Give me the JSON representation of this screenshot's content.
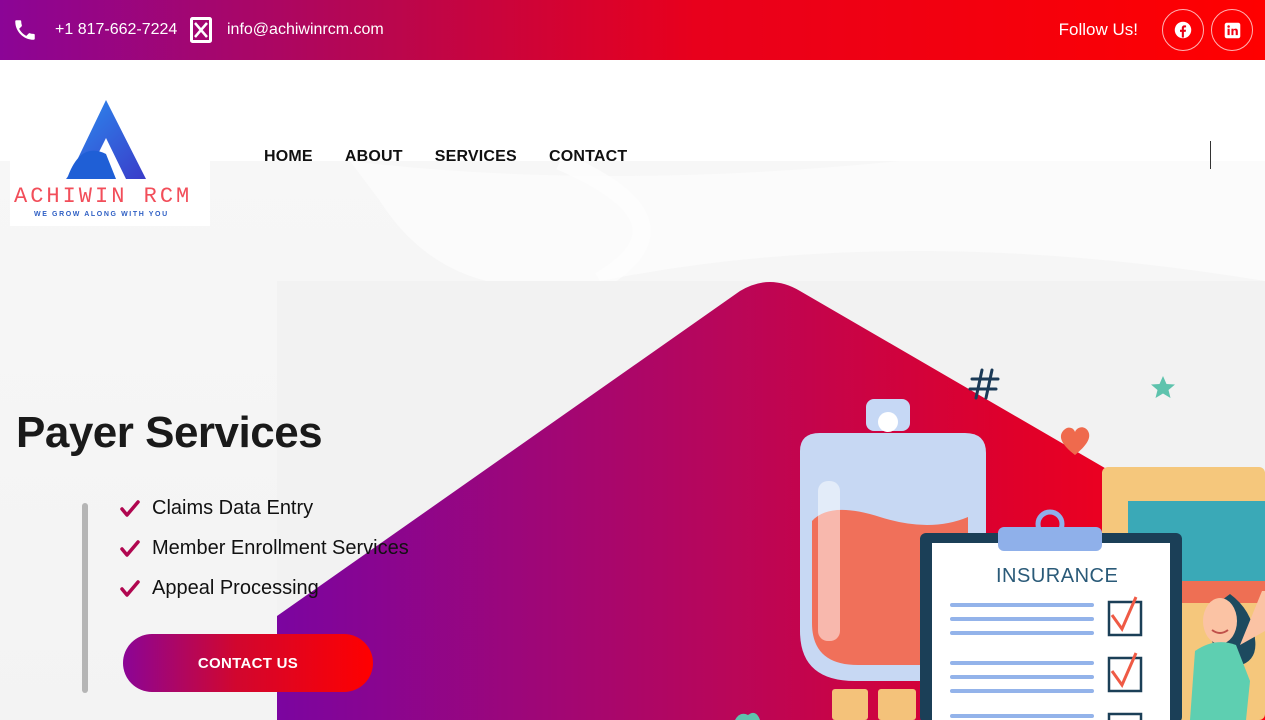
{
  "topbar": {
    "phone": "+1 817-662-7224",
    "email": "info@achiwinrcm.com",
    "follow": "Follow Us!"
  },
  "brand": {
    "name": "ACHIWIN RCM",
    "tagline": "WE GROW ALONG WITH YOU"
  },
  "nav": {
    "items": [
      "HOME",
      "ABOUT",
      "SERVICES",
      "CONTACT"
    ]
  },
  "hero": {
    "title": "Payer Services",
    "services": [
      "Claims Data Entry",
      "Member Enrollment Services",
      "Appeal Processing"
    ],
    "cta": "CONTACT US",
    "clipboard_label": "INSURANCE"
  },
  "colors": {
    "gradient_start": "#8b0596",
    "gradient_end": "#ff0000",
    "check": "#b0064f"
  },
  "icons": [
    "phone-icon",
    "email-icon",
    "facebook-icon",
    "linkedin-icon",
    "check-icon"
  ]
}
